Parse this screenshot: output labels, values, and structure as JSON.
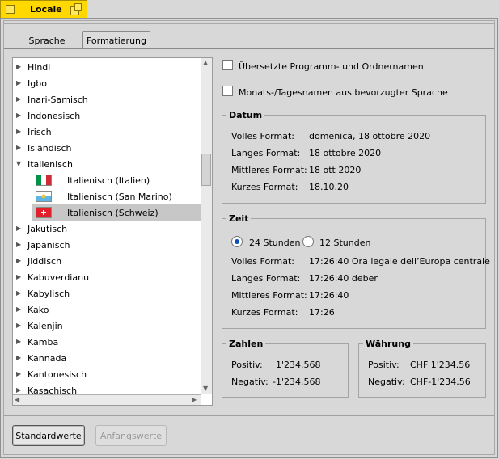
{
  "window": {
    "title": "Locale"
  },
  "tabs": [
    {
      "label": "Sprache"
    },
    {
      "label": "Formatierung"
    }
  ],
  "languages": [
    {
      "label": "Hindi",
      "type": "collapsed"
    },
    {
      "label": "Igbo",
      "type": "collapsed"
    },
    {
      "label": "Inari-Samisch",
      "type": "collapsed"
    },
    {
      "label": "Indonesisch",
      "type": "collapsed"
    },
    {
      "label": "Irisch",
      "type": "collapsed"
    },
    {
      "label": "Isländisch",
      "type": "collapsed"
    },
    {
      "label": "Italienisch",
      "type": "expanded"
    },
    {
      "label": "Italienisch (Italien)",
      "type": "child",
      "flag": "italy-flag"
    },
    {
      "label": "Italienisch (San Marino)",
      "type": "child",
      "flag": "san-marino-flag"
    },
    {
      "label": "Italienisch (Schweiz)",
      "type": "selected",
      "flag": "switzerland-flag"
    },
    {
      "label": "Jakutisch",
      "type": "collapsed"
    },
    {
      "label": "Japanisch",
      "type": "collapsed"
    },
    {
      "label": "Jiddisch",
      "type": "collapsed"
    },
    {
      "label": "Kabuverdianu",
      "type": "collapsed"
    },
    {
      "label": "Kabylisch",
      "type": "collapsed"
    },
    {
      "label": "Kako",
      "type": "collapsed"
    },
    {
      "label": "Kalenjin",
      "type": "collapsed"
    },
    {
      "label": "Kamba",
      "type": "collapsed"
    },
    {
      "label": "Kannada",
      "type": "collapsed"
    },
    {
      "label": "Kantonesisch",
      "type": "collapsed"
    },
    {
      "label": "Kasachisch",
      "type": "collapsed"
    }
  ],
  "options": {
    "translated_names": {
      "label": "Übersetzte Programm- und Ordnernamen",
      "checked": false
    },
    "month_day_names": {
      "label": "Monats-/Tagesnamen aus bevorzugter Sprache",
      "checked": false
    }
  },
  "datum": {
    "title": "Datum",
    "rows": [
      {
        "label": "Volles Format:",
        "value": "domenica, 18 ottobre 2020"
      },
      {
        "label": "Langes Format:",
        "value": "18 ottobre 2020"
      },
      {
        "label": "Mittleres Format:",
        "value": "18 ott 2020"
      },
      {
        "label": "Kurzes Format:",
        "value": "18.10.20"
      }
    ]
  },
  "zeit": {
    "title": "Zeit",
    "radio_24": {
      "label": "24 Stunden",
      "selected": true
    },
    "radio_12": {
      "label": "12 Stunden",
      "selected": false
    },
    "rows": [
      {
        "label": "Volles Format:",
        "value": "17:26:40 Ora legale dell’Europa centrale"
      },
      {
        "label": "Langes Format:",
        "value": "17:26:40 deber"
      },
      {
        "label": "Mittleres Format:",
        "value": "17:26:40"
      },
      {
        "label": "Kurzes Format:",
        "value": "17:26"
      }
    ]
  },
  "zahlen": {
    "title": "Zahlen",
    "positive_label": "Positiv:",
    "positive_value": "1'234.568",
    "negative_label": "Negativ:",
    "negative_value": "-1'234.568"
  },
  "waehrung": {
    "title": "Währung",
    "positive_label": "Positiv:",
    "positive_value": "CHF 1'234.56",
    "negative_label": "Negativ:",
    "negative_value": "CHF-1'234.56"
  },
  "buttons": {
    "defaults": "Standardwerte",
    "revert": "Anfangswerte"
  },
  "colors": {
    "window_tab": "#ffd800",
    "selection": "#c7c7c7",
    "radio_dot": "#0a50b8"
  }
}
